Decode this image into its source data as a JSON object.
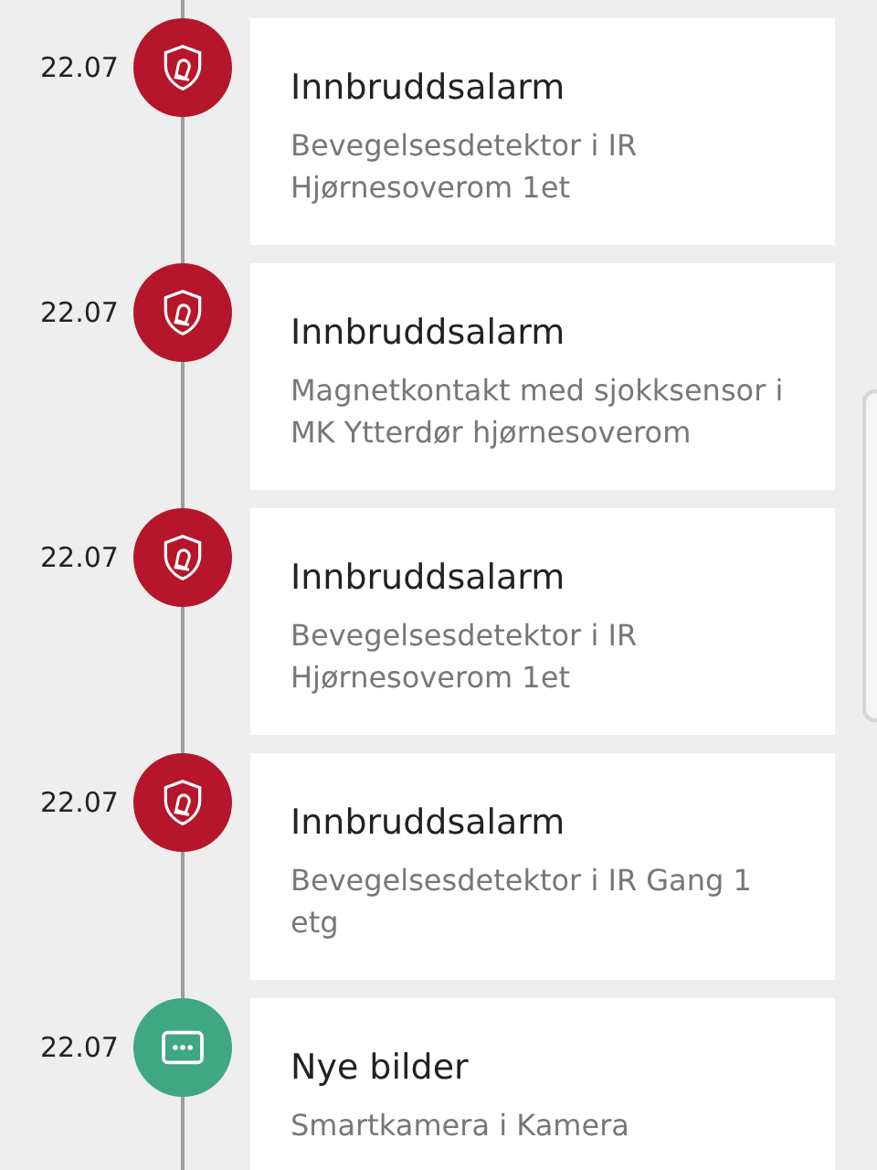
{
  "events": [
    {
      "date": "22.07",
      "kind": "alarm",
      "title": "Innbruddsalarm",
      "subtitle": "Bevegelsesdetektor i IR Hjørnesoverom 1et"
    },
    {
      "date": "22.07",
      "kind": "alarm",
      "title": "Innbruddsalarm",
      "subtitle": "Magnetkontakt med sjokksensor i MK Ytterdør hjørnesoverom"
    },
    {
      "date": "22.07",
      "kind": "alarm",
      "title": "Innbruddsalarm",
      "subtitle": "Bevegelsesdetektor i IR Hjørnesoverom 1et"
    },
    {
      "date": "22.07",
      "kind": "alarm",
      "title": "Innbruddsalarm",
      "subtitle": "Bevegelsesdetektor i IR Gang 1 etg"
    },
    {
      "date": "22.07",
      "kind": "message",
      "title": "Nye bilder",
      "subtitle": "Smartkamera i Kamera"
    }
  ]
}
